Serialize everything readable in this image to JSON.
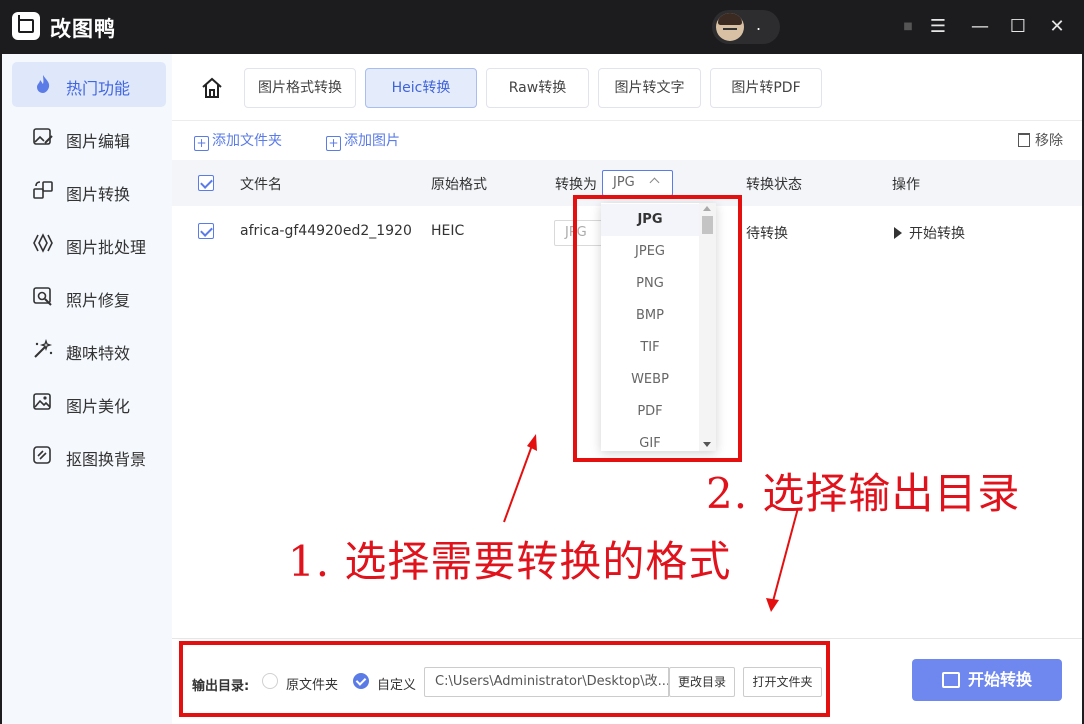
{
  "app": {
    "name": "改图鸭",
    "user_name": "."
  },
  "window_controls": {
    "menu": "☰",
    "minimize": "—",
    "maximize": "☐",
    "close": "✕"
  },
  "sidebar": {
    "items": [
      {
        "label": "热门功能",
        "icon": "flame-icon",
        "active": true
      },
      {
        "label": "图片编辑",
        "icon": "image-edit-icon"
      },
      {
        "label": "图片转换",
        "icon": "image-convert-icon"
      },
      {
        "label": "图片批处理",
        "icon": "batch-icon"
      },
      {
        "label": "照片修复",
        "icon": "photo-repair-icon"
      },
      {
        "label": "趣味特效",
        "icon": "magic-wand-icon"
      },
      {
        "label": "图片美化",
        "icon": "image-beautify-icon"
      },
      {
        "label": "抠图换背景",
        "icon": "cutout-icon"
      }
    ]
  },
  "tabs": [
    {
      "label": "图片格式转换"
    },
    {
      "label": "Heic转换",
      "active": true
    },
    {
      "label": "Raw转换"
    },
    {
      "label": "图片转文字"
    },
    {
      "label": "图片转PDF"
    }
  ],
  "toolbar": {
    "add_folder": "添加文件夹",
    "add_image": "添加图片",
    "remove": "移除"
  },
  "table": {
    "headers": {
      "name": "文件名",
      "orig_format": "原始格式",
      "convert_to": "转换为",
      "status": "转换状态",
      "action": "操作"
    },
    "header_format_value": "JPG",
    "rows": [
      {
        "name": "africa-gf44920ed2_1920",
        "orig_format": "HEIC",
        "convert_to": "JPG",
        "status": "待转换",
        "action": "开始转换"
      }
    ]
  },
  "dropdown": {
    "options": [
      "JPG",
      "JPEG",
      "PNG",
      "BMP",
      "TIF",
      "WEBP",
      "PDF",
      "GIF"
    ],
    "selected": "JPG"
  },
  "bottom": {
    "output_label": "输出目录:",
    "radio_original": "原文件夹",
    "radio_custom": "自定义",
    "path": "C:\\Users\\Administrator\\Desktop\\改...",
    "change_dir": "更改目录",
    "open_folder": "打开文件夹",
    "start_button": "开始转换"
  },
  "annotations": {
    "step1": "1. 选择需要转换的格式",
    "step2": "2. 选择输出目录",
    "color": "#e41010"
  }
}
